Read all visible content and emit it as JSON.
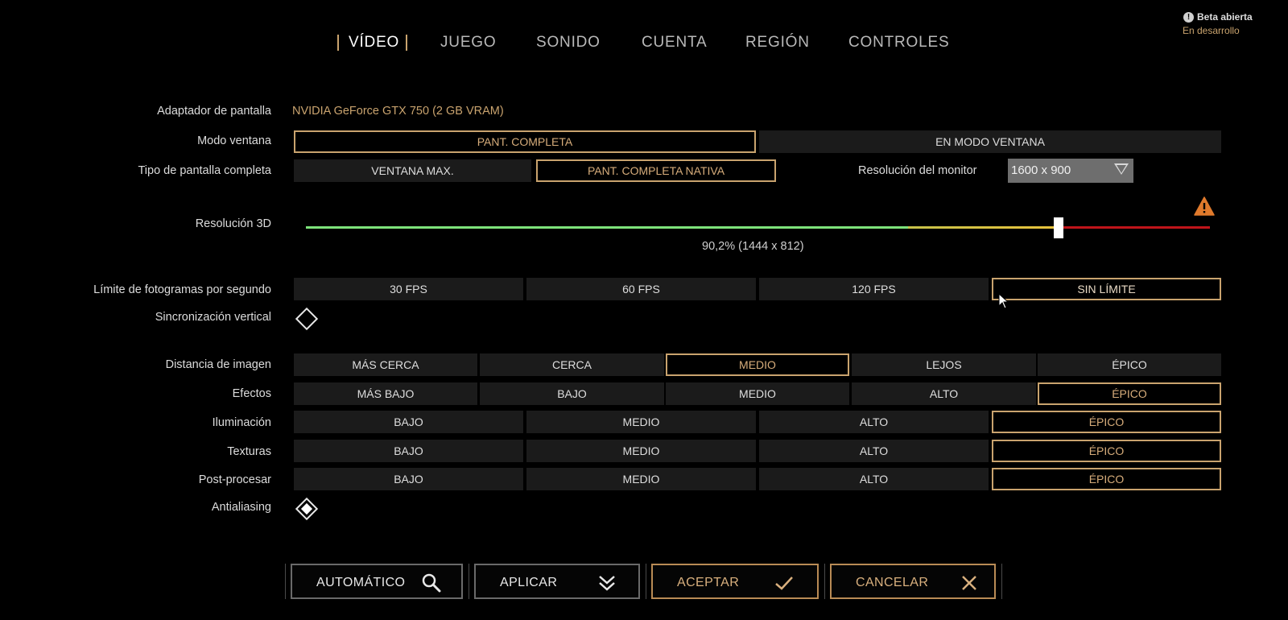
{
  "tabs": [
    "VÍDEO",
    "JUEGO",
    "SONIDO",
    "CUENTA",
    "REGIÓN",
    "CONTROLES"
  ],
  "active_tab": "VÍDEO",
  "beta": {
    "title": "Beta abierta",
    "subtitle": "En desarrollo"
  },
  "adapter": {
    "label": "Adaptador de pantalla",
    "value": "NVIDIA GeForce GTX 750 (2 GB VRAM)"
  },
  "window_mode": {
    "label": "Modo ventana",
    "options": [
      "PANT. COMPLETA",
      "EN MODO VENTANA"
    ],
    "selected": "PANT. COMPLETA"
  },
  "fullscreen_type": {
    "label": "Tipo de pantalla completa",
    "options": [
      "VENTANA MAX.",
      "PANT. COMPLETA NATIVA"
    ],
    "selected": "PANT. COMPLETA NATIVA"
  },
  "monitor_resolution": {
    "label": "Resolución del monitor",
    "value": "1600 x 900"
  },
  "resolution_3d": {
    "label": "Resolución 3D",
    "percent": 90.2,
    "readout": "90,2%  (1444 x 812)"
  },
  "fps_limit": {
    "label": "Límite de fotogramas por segundo",
    "options": [
      "30 FPS",
      "60 FPS",
      "120 FPS",
      "SIN LÍMITE"
    ],
    "selected": "SIN LÍMITE"
  },
  "vsync": {
    "label": "Sincronización vertical",
    "checked": false
  },
  "view_distance": {
    "label": "Distancia de imagen",
    "options": [
      "MÁS CERCA",
      "CERCA",
      "MEDIO",
      "LEJOS",
      "ÉPICO"
    ],
    "selected": "MEDIO"
  },
  "effects": {
    "label": "Efectos",
    "options": [
      "MÁS BAJO",
      "BAJO",
      "MEDIO",
      "ALTO",
      "ÉPICO"
    ],
    "selected": "ÉPICO"
  },
  "lighting": {
    "label": "Iluminación",
    "options": [
      "BAJO",
      "MEDIO",
      "ALTO",
      "ÉPICO"
    ],
    "selected": "ÉPICO"
  },
  "textures": {
    "label": "Texturas",
    "options": [
      "BAJO",
      "MEDIO",
      "ALTO",
      "ÉPICO"
    ],
    "selected": "ÉPICO"
  },
  "post_processing": {
    "label": "Post-procesar",
    "options": [
      "BAJO",
      "MEDIO",
      "ALTO",
      "ÉPICO"
    ],
    "selected": "ÉPICO"
  },
  "antialiasing": {
    "label": "Antialiasing",
    "checked": true
  },
  "buttons": {
    "auto": "AUTOMÁTICO",
    "apply": "APLICAR",
    "accept": "ACEPTAR",
    "cancel": "CANCELAR"
  },
  "colors": {
    "accent": "#c9a36e",
    "slider_green": "#7de37a",
    "slider_yellow": "#e8c23b",
    "slider_red": "#c0141a",
    "warning": "#e07a2c"
  }
}
